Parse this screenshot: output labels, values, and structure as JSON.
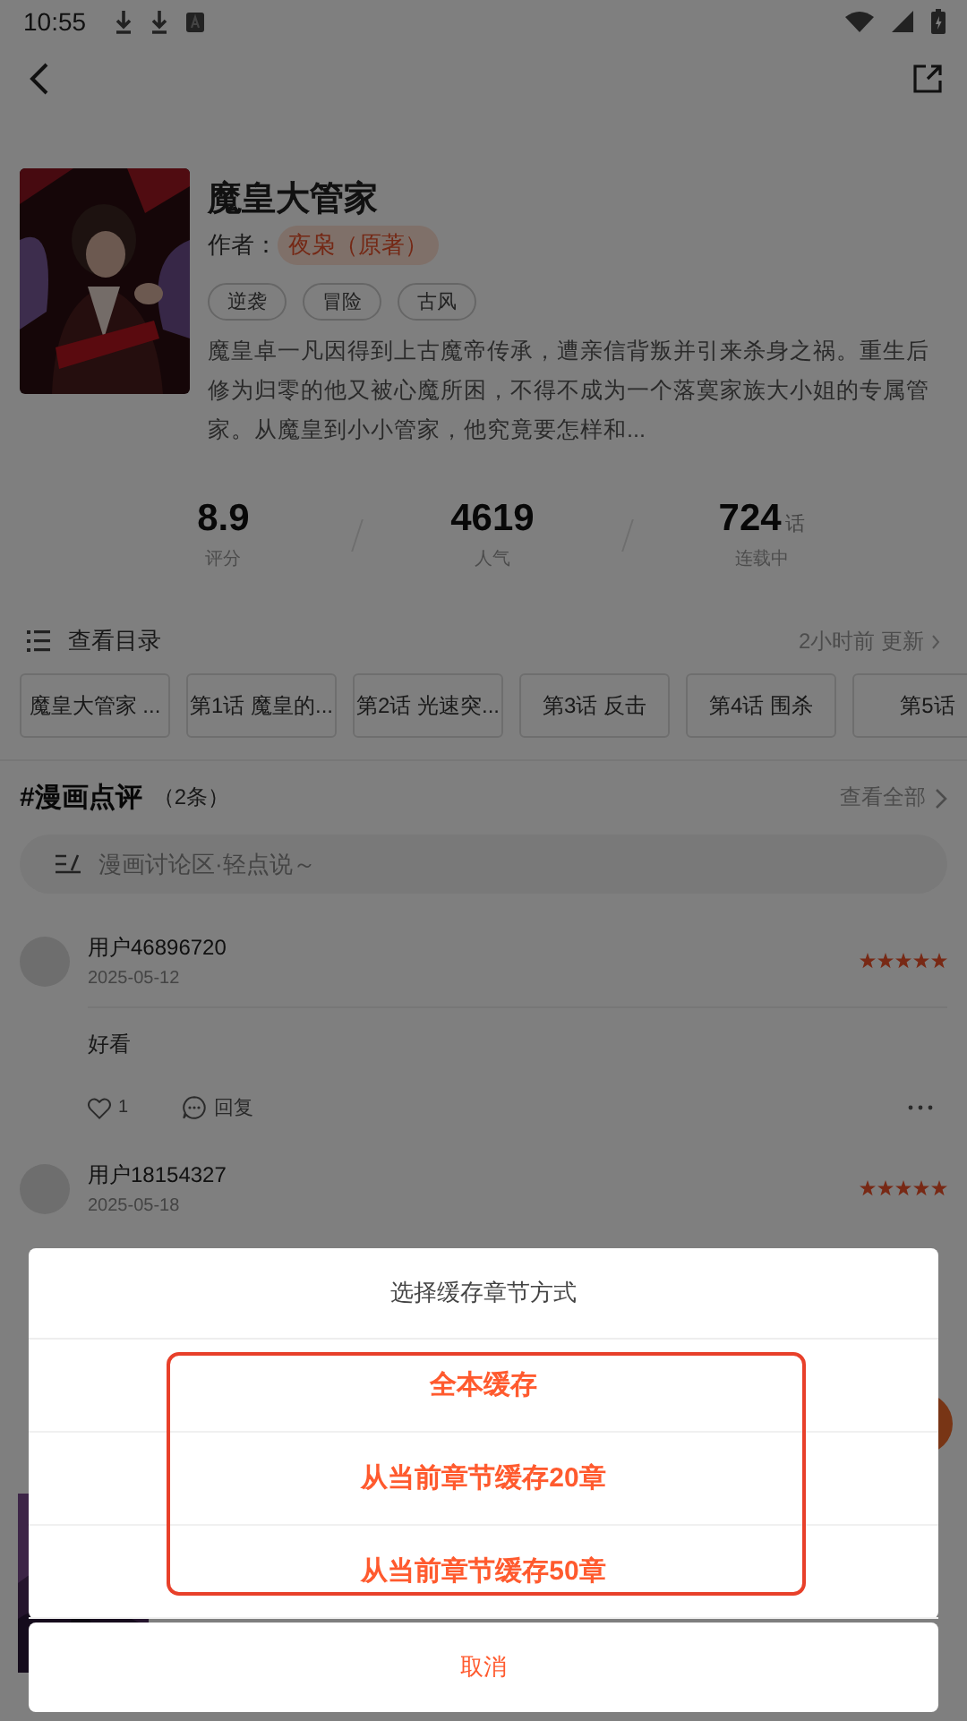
{
  "status_bar": {
    "time": "10:55"
  },
  "comic": {
    "title": "魔皇大管家",
    "author_label": "作者：",
    "author": "夜枭（原著）",
    "tags": [
      "逆袭",
      "冒险",
      "古风"
    ],
    "description": "魔皇卓一凡因得到上古魔帝传承，遭亲信背叛并引来杀身之祸。重生后修为归零的他又被心魔所困，不得不成为一个落寞家族大小姐的专属管家。从魔皇到小小管家，他究竟要怎样和..."
  },
  "stats": [
    {
      "value": "8.9",
      "label": "评分"
    },
    {
      "value": "4619",
      "label": "人气"
    },
    {
      "value": "724",
      "unit": "话",
      "label": "连载中"
    }
  ],
  "catalog": {
    "label": "查看目录",
    "updated": "2小时前 更新",
    "chapters": [
      "魔皇大管家 ...",
      "第1话 魔皇的...",
      "第2话 光速突...",
      "第3话 反击",
      "第4话 围杀",
      "第5话"
    ]
  },
  "reviews": {
    "title": "#漫画点评",
    "count": "（2条）",
    "view_all": "查看全部",
    "placeholder": "漫画讨论区·轻点说～",
    "comments": [
      {
        "user": "用户46896720",
        "date": "2025-05-12",
        "stars": 5,
        "text": "好看",
        "likes": "1",
        "reply": "回复"
      },
      {
        "user": "用户18154327",
        "date": "2025-05-18",
        "stars": 5
      }
    ]
  },
  "dialog": {
    "title": "选择缓存章节方式",
    "framed": true,
    "options": [
      "全本缓存",
      "从当前章节缓存20章",
      "从当前章节缓存50章"
    ],
    "cancel": "取消"
  }
}
